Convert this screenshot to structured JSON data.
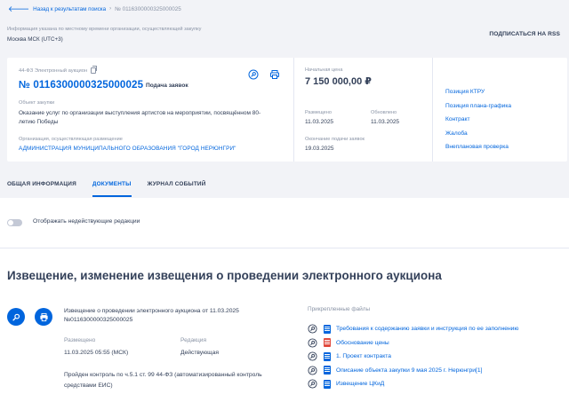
{
  "breadcrumb": {
    "back_label": "Назад к результатам поиска",
    "current": "№ 0116300000325000025"
  },
  "header": {
    "timezone_info": "Информация указана по местному времени организации, осуществляющей закупку",
    "timezone_value": "Москва МСК (UTC+3)",
    "subscribe_label": "ПОДПИСАТЬСЯ НА RSS"
  },
  "card": {
    "law_type": "44-ФЗ Электронный аукцион",
    "number": "№ 0116300000325000025",
    "stage": "Подача заявок",
    "object_label": "Объект закупки",
    "object_text": "Оказание услуг по организации выступления артистов на мероприятии, посвящённом 80-летию Победы",
    "org_label": "Организация, осуществляющая размещение",
    "org_name": "АДМИНИСТРАЦИЯ МУНИЦИПАЛЬНОГО ОБРАЗОВАНИЯ \"ГОРОД НЕРЮНГРИ\"",
    "price_label": "Начальная цена",
    "price": "7 150 000,00 ₽",
    "placed_label": "Размещено",
    "placed_date": "11.03.2025",
    "updated_label": "Обновлено",
    "updated_date": "11.03.2025",
    "deadline_label": "Окончание подачи заявок",
    "deadline_date": "19.03.2025",
    "links": [
      "Позиция КТРУ",
      "Позиция плана-графика",
      "Контракт",
      "Жалоба",
      "Внеплановая проверка"
    ]
  },
  "tabs": [
    "ОБЩАЯ ИНФОРМАЦИЯ",
    "ДОКУМЕНТЫ",
    "ЖУРНАЛ СОБЫТИЙ"
  ],
  "toggle_label": "Отображать недействующие редакции",
  "documents": {
    "title": "Извещение, изменение извещения о проведении электронного аукциона",
    "notice_title": "Извещение о проведении электронного аукциона от 11.03.2025 №0116300000325000025",
    "placed_label": "Размещено",
    "placed_value": "11.03.2025 05:55 (МСК)",
    "edition_label": "Редакция",
    "edition_value": "Действующая",
    "control_text": "Пройден контроль по ч.5.1 ст. 99 44-ФЗ (автоматизированный контроль средствами ЕИС)",
    "attached_label": "Прикрепленные файлы",
    "attachments": [
      {
        "name": "Требования к содержанию заявки и инструкция по ее заполнению",
        "file_color": "#0065dd"
      },
      {
        "name": "Обоснование цены",
        "file_color": "#e0493c"
      },
      {
        "name": "1. Проект контракта",
        "file_color": "#0065dd"
      },
      {
        "name": "Описание объекта закупки 9 мая 2025 г. Нерюнгри[1]",
        "file_color": "#0065dd"
      },
      {
        "name": "Извещение ЦКиД",
        "file_color": "#0065dd"
      }
    ]
  },
  "colors": {
    "accent": "#0065dd",
    "text": "#334059",
    "muted": "#8a94a6",
    "pdf": "#e0493c"
  }
}
